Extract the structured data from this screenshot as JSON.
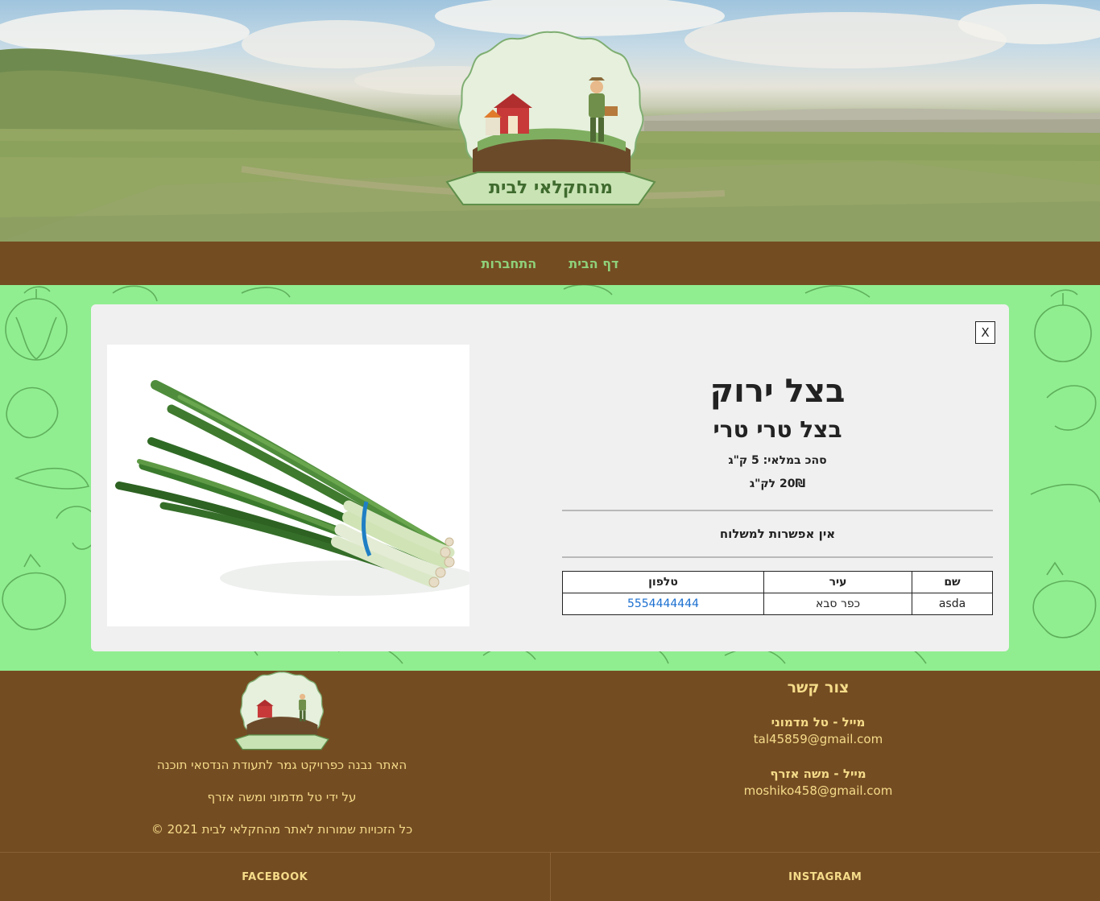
{
  "logo": {
    "text": "מהחקלאי לבית"
  },
  "nav": {
    "home": "דף הבית",
    "login": "התחברות"
  },
  "modal": {
    "close_label": "X",
    "product_image_alt": "בצל ירוק",
    "title": "בצל ירוק",
    "subtitle": "בצל טרי טרי",
    "stock": "סהכ במלאי: 5 ק\"ג",
    "price": "20₪ לק\"ג",
    "delivery": "אין אפשרות למשלוח",
    "table": {
      "headers": {
        "name": "שם",
        "city": "עיר",
        "phone": "טלפון"
      },
      "rows": [
        {
          "name": "asda",
          "city": "כפר סבא",
          "phone": "5554444444"
        }
      ]
    }
  },
  "footer": {
    "line1": "האתר נבנה כפרויקט גמר לתעודת הנדסאי תוכנה",
    "line2": "על ידי טל מדמוני ומשה אזרף",
    "copyright": "כל הזכויות שמורות לאתר מהחקלאי לבית  2021  ©",
    "contact_title": "צור קשר",
    "contact1_name": "מייל - טל מדמוני",
    "contact1_email": "tal45859@gmail.com",
    "contact2_name": "מייל - משה אזרף",
    "contact2_email": "moshiko458@gmail.com"
  },
  "social": {
    "facebook": "FACEBOOK",
    "instagram": "INSTAGRAM"
  },
  "colors": {
    "brown": "#744c22",
    "green_bg": "#90ee90",
    "nav_text": "#8fd17a",
    "footer_text": "#f5dc8a",
    "link": "#1a6fd1"
  }
}
